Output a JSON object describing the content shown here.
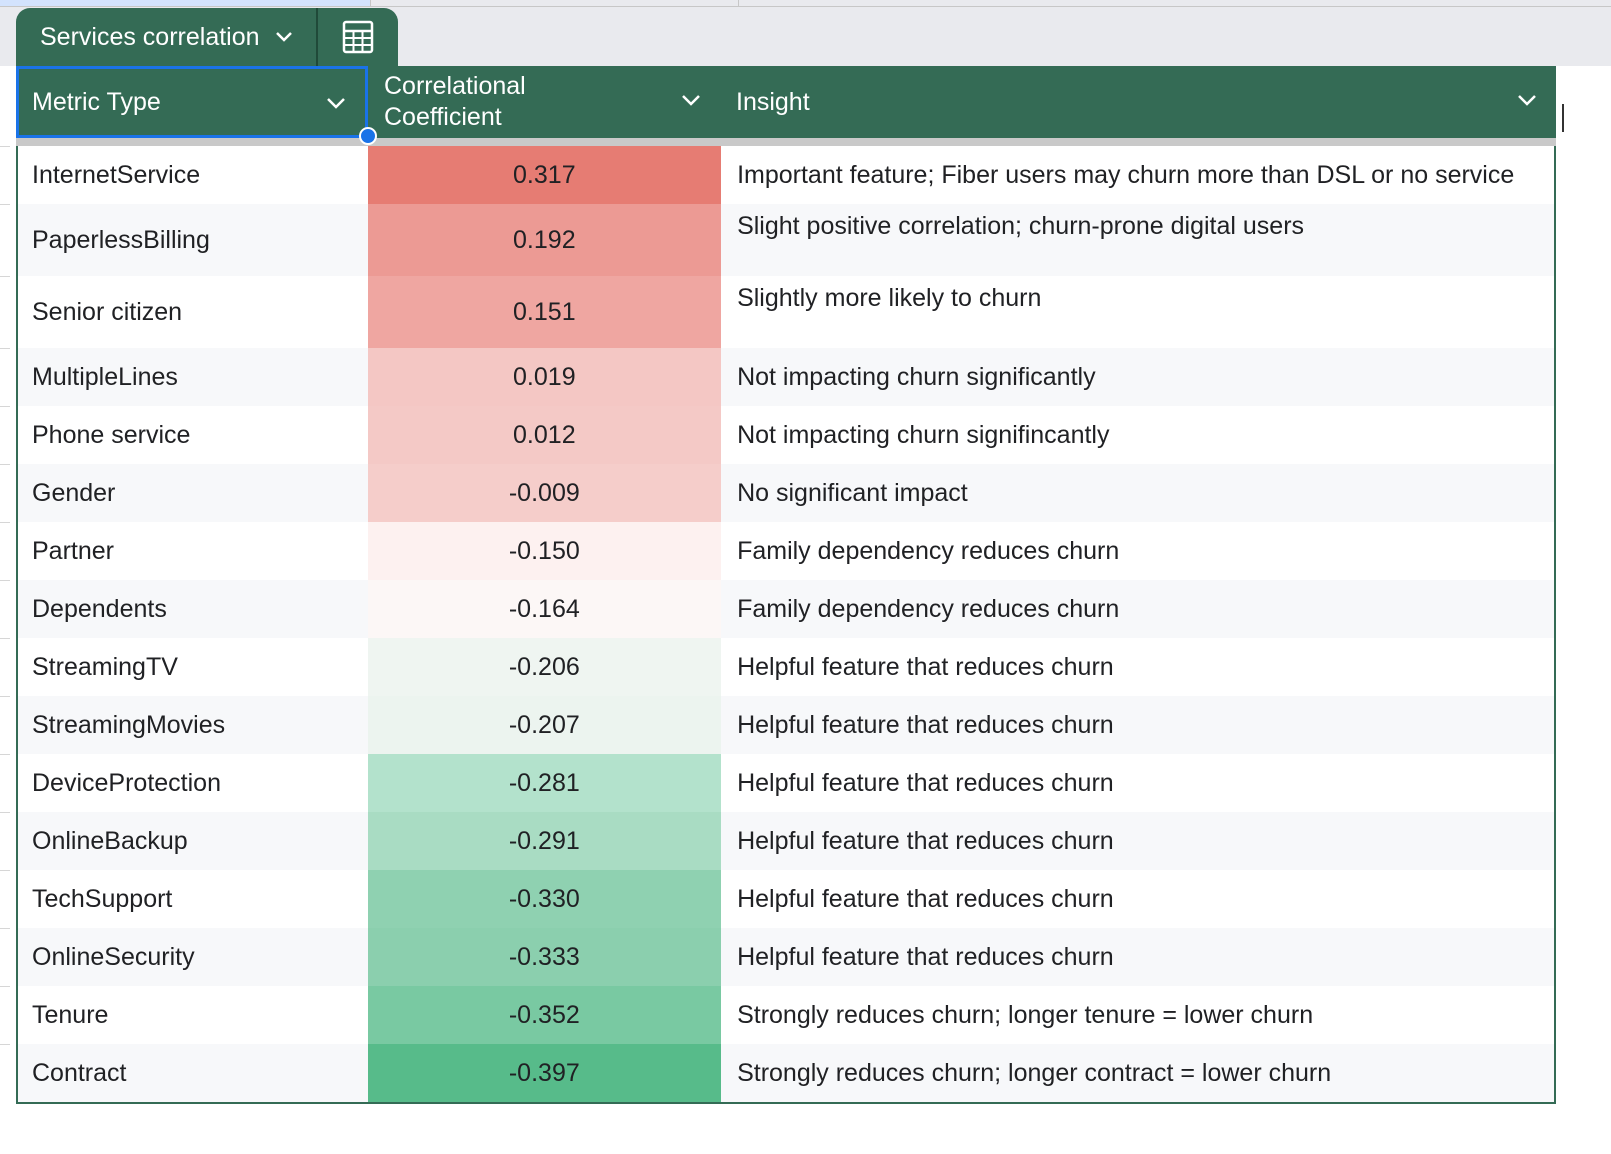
{
  "table": {
    "name": "Services correlation",
    "columns": [
      "Metric Type",
      "Correlational Coefficient",
      "Insight"
    ],
    "rows": [
      {
        "metric": "InternetService",
        "coef": "0.317",
        "insight": "Important feature; Fiber users may churn more than DSL or no service",
        "color": "#e67c73"
      },
      {
        "metric": "PaperlessBilling",
        "coef": "0.192",
        "insight": "Slight positive correlation; churn-prone digital users",
        "color": "#ec9a94"
      },
      {
        "metric": "Senior citizen",
        "coef": "0.151",
        "insight": "Slightly more likely to churn",
        "color": "#efa6a1"
      },
      {
        "metric": "MultipleLines",
        "coef": "0.019",
        "insight": "Not impacting churn significantly",
        "color": "#f4c7c4"
      },
      {
        "metric": "Phone service",
        "coef": "0.012",
        "insight": "Not impacting churn signifincantly",
        "color": "#f4c9c6"
      },
      {
        "metric": "Gender",
        "coef": "-0.009",
        "insight": "No significant impact",
        "color": "#f5cdca"
      },
      {
        "metric": "Partner",
        "coef": "-0.150",
        "insight": "Family dependency reduces churn",
        "color": "#fdf1f0"
      },
      {
        "metric": "Dependents",
        "coef": "-0.164",
        "insight": "Family dependency reduces churn",
        "color": "#fcf7f6"
      },
      {
        "metric": "StreamingTV",
        "coef": "-0.206",
        "insight": "Helpful feature that reduces churn",
        "color": "#eff5f1"
      },
      {
        "metric": "StreamingMovies",
        "coef": "-0.207",
        "insight": "Helpful feature that reduces churn",
        "color": "#ecf4ef"
      },
      {
        "metric": "DeviceProtection",
        "coef": "-0.281",
        "insight": "Helpful feature that reduces churn",
        "color": "#b3e2cc"
      },
      {
        "metric": "OnlineBackup",
        "coef": "-0.291",
        "insight": "Helpful feature that reduces churn",
        "color": "#a9dcc3"
      },
      {
        "metric": "TechSupport",
        "coef": "-0.330",
        "insight": "Helpful feature that reduces churn",
        "color": "#8fd1b1"
      },
      {
        "metric": "OnlineSecurity",
        "coef": "-0.333",
        "insight": "Helpful feature that reduces churn",
        "color": "#8bcfae"
      },
      {
        "metric": "Tenure",
        "coef": "-0.352",
        "insight": "Strongly reduces churn; longer tenure = lower churn",
        "color": "#79c9a2"
      },
      {
        "metric": "Contract",
        "coef": "-0.397",
        "insight": "Strongly reduces churn; longer contract = lower churn",
        "color": "#57bb8a"
      }
    ]
  },
  "colors": {
    "header_bg": "#346b55",
    "selection_blue": "#1a73e8"
  }
}
